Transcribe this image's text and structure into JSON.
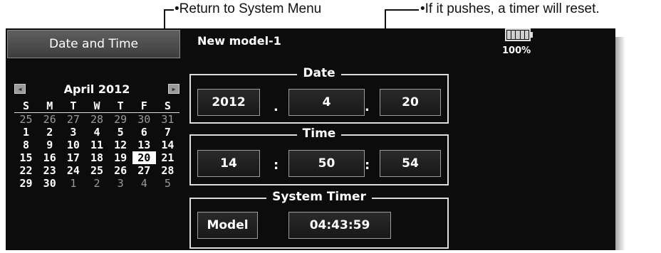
{
  "annotations": {
    "return_note": "Return to System Menu",
    "reset_note": "If it pushes, a timer will reset."
  },
  "header": {
    "title": "Date and Time",
    "model": "New model-1",
    "battery": "100%"
  },
  "calendar": {
    "month": "April 2012",
    "prev_icon": "triangle-left",
    "next_icon": "triangle-right",
    "weekdays": [
      "S",
      "M",
      "T",
      "W",
      "T",
      "F",
      "S"
    ],
    "days": [
      [
        "25",
        "26",
        "27",
        "28",
        "29",
        "30",
        "31"
      ],
      [
        "1",
        "2",
        "3",
        "4",
        "5",
        "6",
        "7"
      ],
      [
        "8",
        "9",
        "10",
        "11",
        "12",
        "13",
        "14"
      ],
      [
        "15",
        "16",
        "17",
        "18",
        "19",
        "20",
        "21"
      ],
      [
        "22",
        "23",
        "24",
        "25",
        "26",
        "27",
        "28"
      ],
      [
        "29",
        "30",
        "1",
        "2",
        "3",
        "4",
        "5"
      ]
    ],
    "selected_day": "20"
  },
  "date": {
    "label": "Date",
    "year": "2012",
    "month": "4",
    "day": "20",
    "sep": "."
  },
  "time": {
    "label": "Time",
    "hour": "14",
    "minute": "50",
    "second": "54",
    "sep": ":"
  },
  "system_timer": {
    "label": "System Timer",
    "mode": "Model",
    "value": "04:43:59"
  },
  "colors": {
    "screen_bg": "#0c0c0c",
    "text": "#ffffff",
    "frame": "#dcdcdc"
  }
}
